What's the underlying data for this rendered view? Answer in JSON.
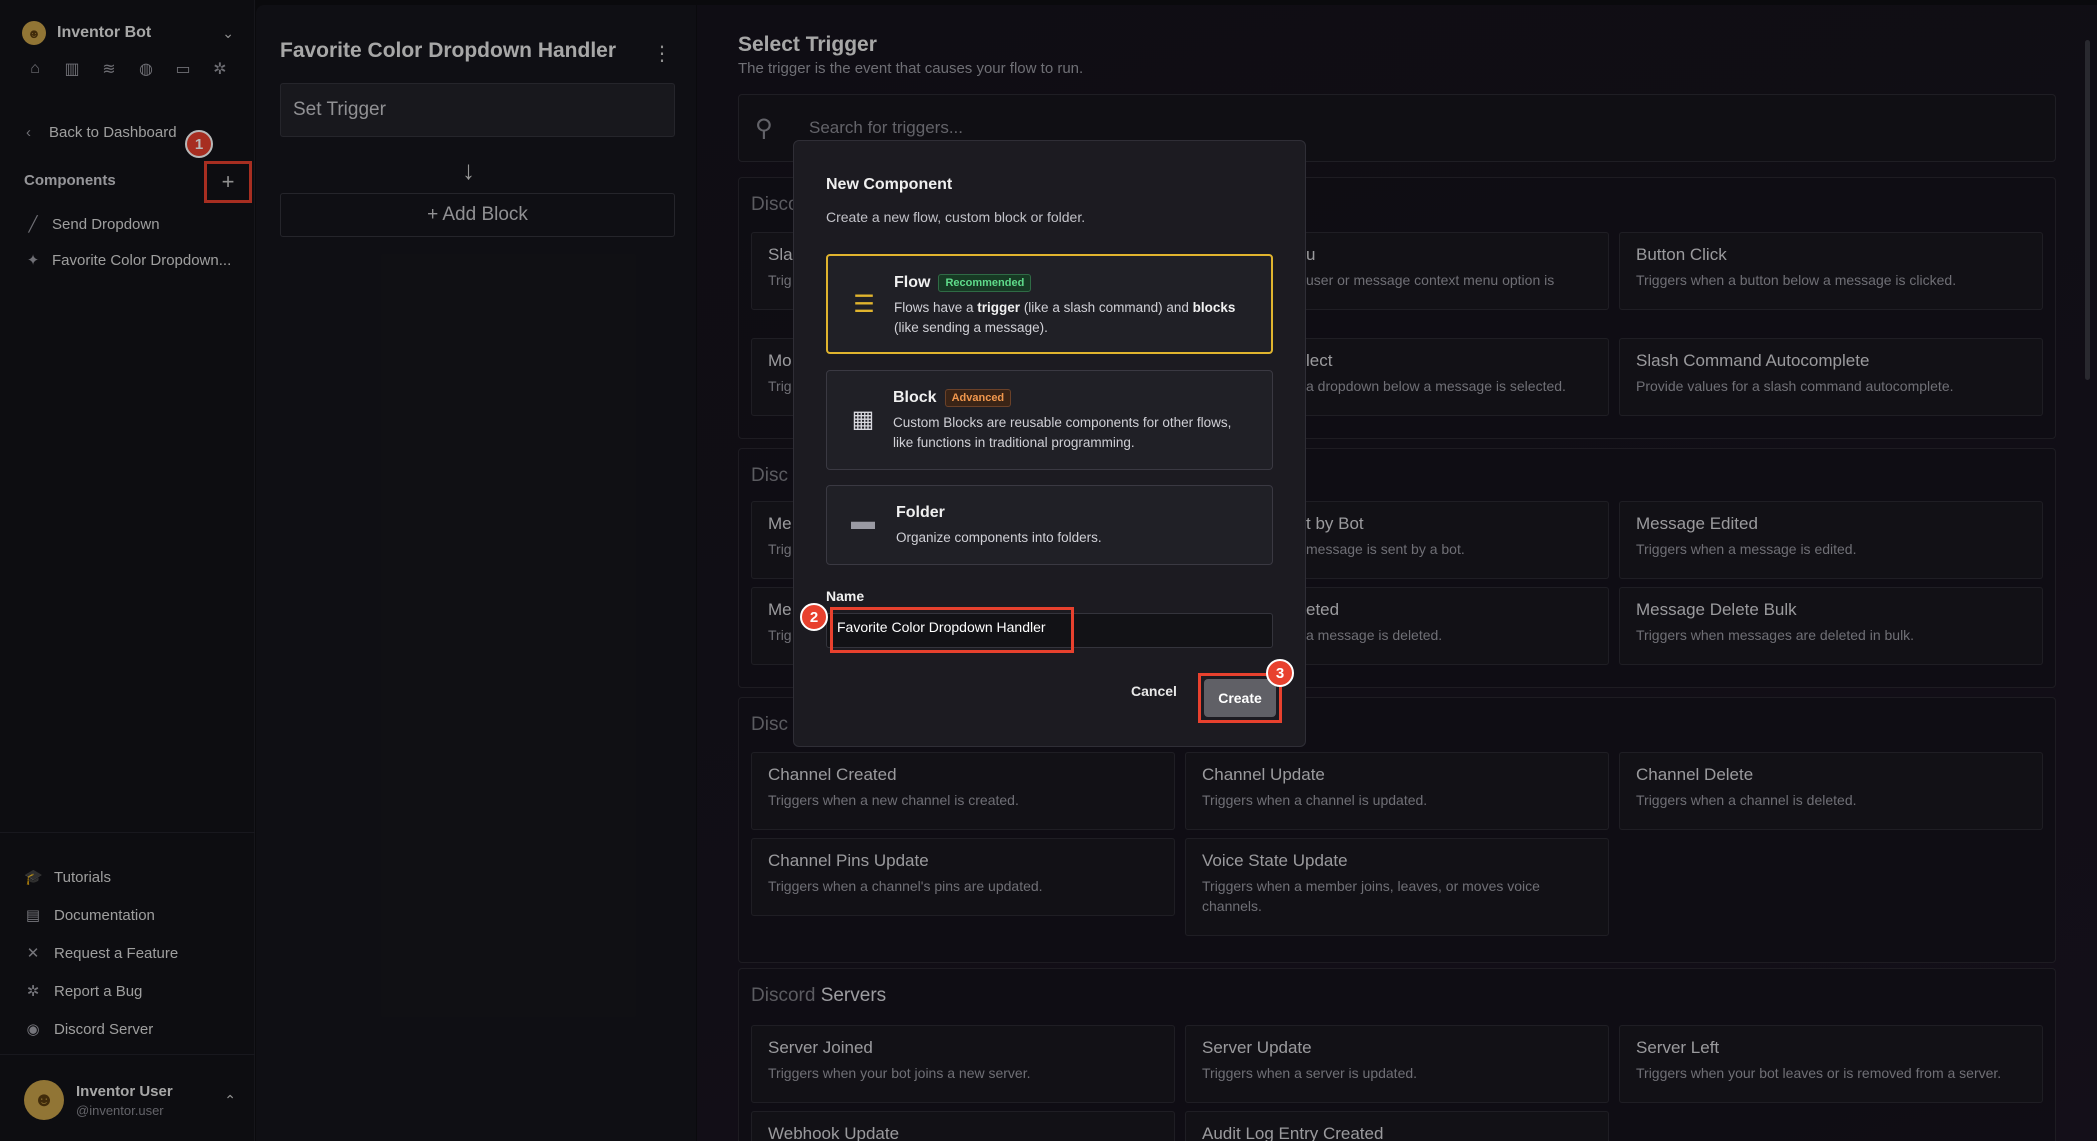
{
  "sidebar": {
    "bot_name": "Inventor Bot",
    "nav_icons": [
      "home-icon",
      "library-icon",
      "database-icon",
      "globe-icon",
      "storage-icon",
      "bug-icon"
    ],
    "back_label": "Back to Dashboard",
    "components_label": "Components",
    "add_badge": "1",
    "items": [
      {
        "label": "Send Dropdown",
        "icon": "slash-icon"
      },
      {
        "label": "Favorite Color Dropdown...",
        "icon": "sparkle-icon"
      }
    ],
    "footer": [
      {
        "label": "Tutorials",
        "icon": "graduation-cap-icon"
      },
      {
        "label": "Documentation",
        "icon": "book-icon"
      },
      {
        "label": "Request a Feature",
        "icon": "tools-icon"
      },
      {
        "label": "Report a Bug",
        "icon": "bug-icon"
      },
      {
        "label": "Discord Server",
        "icon": "discord-icon"
      }
    ],
    "user": {
      "name": "Inventor User",
      "handle": "@inventor.user"
    }
  },
  "flow": {
    "title": "Favorite Color Dropdown Handler",
    "set_trigger": "Set Trigger",
    "add_block": "+ Add Block"
  },
  "main": {
    "title": "Select Trigger",
    "subtitle": "The trigger is the event that causes your flow to run.",
    "search_placeholder": "Search for triggers...",
    "sections": [
      {
        "prefix": "Disco",
        "name": "",
        "cards": [
          {
            "title": "Sla",
            "desc": "Trig"
          },
          {
            "title": "u",
            "desc": "user or message context menu option is"
          },
          {
            "title": "Button Click",
            "desc": "Triggers when a button below a message is clicked."
          },
          {
            "title": "Mo",
            "desc": "Trig"
          },
          {
            "title": "lect",
            "desc": "a dropdown below a message is selected."
          },
          {
            "title": "Slash Command Autocomplete",
            "desc": "Provide values for a slash command autocomplete."
          }
        ]
      },
      {
        "prefix": "Disc",
        "name": "",
        "cards": [
          {
            "title": "Me",
            "desc": "Trig"
          },
          {
            "title": "t by Bot",
            "desc": "message is sent by a bot."
          },
          {
            "title": "Message Edited",
            "desc": "Triggers when a message is edited."
          },
          {
            "title": "Me",
            "desc": "Trig"
          },
          {
            "title": "eted",
            "desc": "a message is deleted."
          },
          {
            "title": "Message Delete Bulk",
            "desc": "Triggers when messages are deleted in bulk."
          }
        ]
      },
      {
        "prefix": "Disc",
        "name": "",
        "cards": [
          {
            "title": "Channel Created",
            "desc": "Triggers when a new channel is created."
          },
          {
            "title": "Channel Update",
            "desc": "Triggers when a channel is updated."
          },
          {
            "title": "Channel Delete",
            "desc": "Triggers when a channel is deleted."
          },
          {
            "title": "Channel Pins Update",
            "desc": "Triggers when a channel's pins are updated."
          },
          {
            "title": "Voice State Update",
            "desc": "Triggers when a member joins, leaves, or moves voice channels."
          }
        ]
      },
      {
        "prefix": "Discord",
        "name": "Servers",
        "cards": [
          {
            "title": "Server Joined",
            "desc": "Triggers when your bot joins a new server."
          },
          {
            "title": "Server Update",
            "desc": "Triggers when a server is updated."
          },
          {
            "title": "Server Left",
            "desc": "Triggers when your bot leaves or is removed from a server."
          },
          {
            "title": "Webhook Update",
            "desc": ""
          },
          {
            "title": "Audit Log Entry Created",
            "desc": ""
          }
        ]
      }
    ]
  },
  "modal": {
    "title": "New Component",
    "subtitle": "Create a new flow, custom block or folder.",
    "options": [
      {
        "title": "Flow",
        "tag": "Recommended",
        "icon": "list-icon",
        "desc_parts": [
          "Flows have a ",
          "trigger",
          " (like a slash command) and ",
          "blocks",
          " (like sending a message)."
        ]
      },
      {
        "title": "Block",
        "tag": "Advanced",
        "icon": "brick-icon",
        "desc": "Custom Blocks are reusable components for other flows, like functions in traditional programming."
      },
      {
        "title": "Folder",
        "tag": "",
        "icon": "folder-icon",
        "desc": "Organize components into folders."
      }
    ],
    "name_label": "Name",
    "name_value": "Favorite Color Dropdown Handler",
    "name_badge": "2",
    "cancel_label": "Cancel",
    "create_label": "Create",
    "create_badge": "3"
  },
  "colors": {
    "accent_highlight": "#e8412e",
    "selected_border": "#e0b42e",
    "tag_recommended": "#5fdb8a",
    "tag_advanced": "#f0974d"
  }
}
